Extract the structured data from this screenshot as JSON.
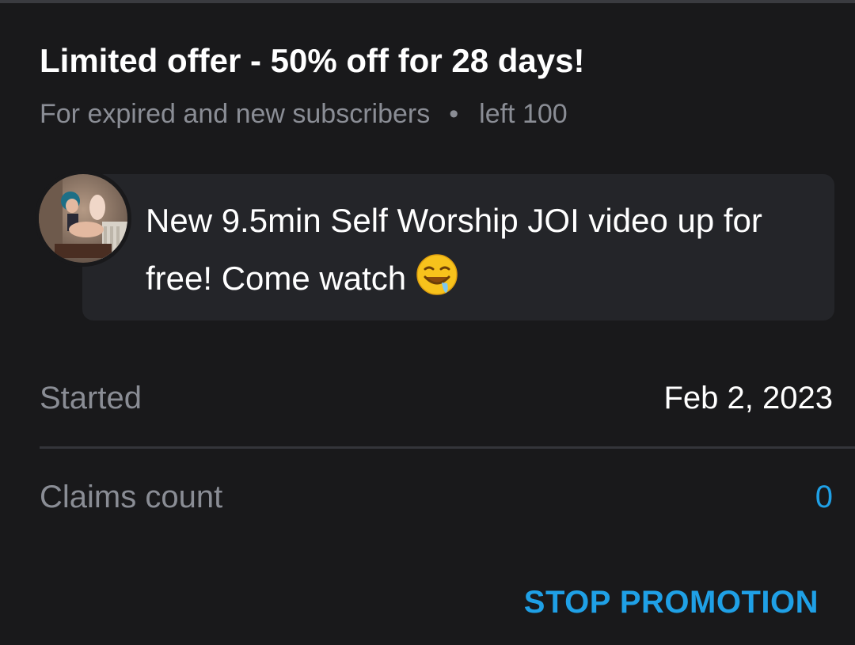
{
  "promotion": {
    "title": "Limited offer - 50% off for 28 days!",
    "audience": "For expired and new subscribers",
    "separator": "•",
    "remaining": "left 100"
  },
  "message": {
    "text": "New 9.5min Self Worship JOI video up for free! Come watch",
    "emoji": "drooling-face-icon",
    "avatar": "creator-avatar"
  },
  "details": {
    "started_label": "Started",
    "started_value": "Feb 2, 2023",
    "claims_label": "Claims count",
    "claims_value": "0"
  },
  "actions": {
    "stop_label": "STOP PROMOTION"
  },
  "colors": {
    "background": "#19191b",
    "bubble": "#242529",
    "muted_text": "#8a8d95",
    "primary_text": "#ffffff",
    "accent": "#1fa0e6"
  }
}
